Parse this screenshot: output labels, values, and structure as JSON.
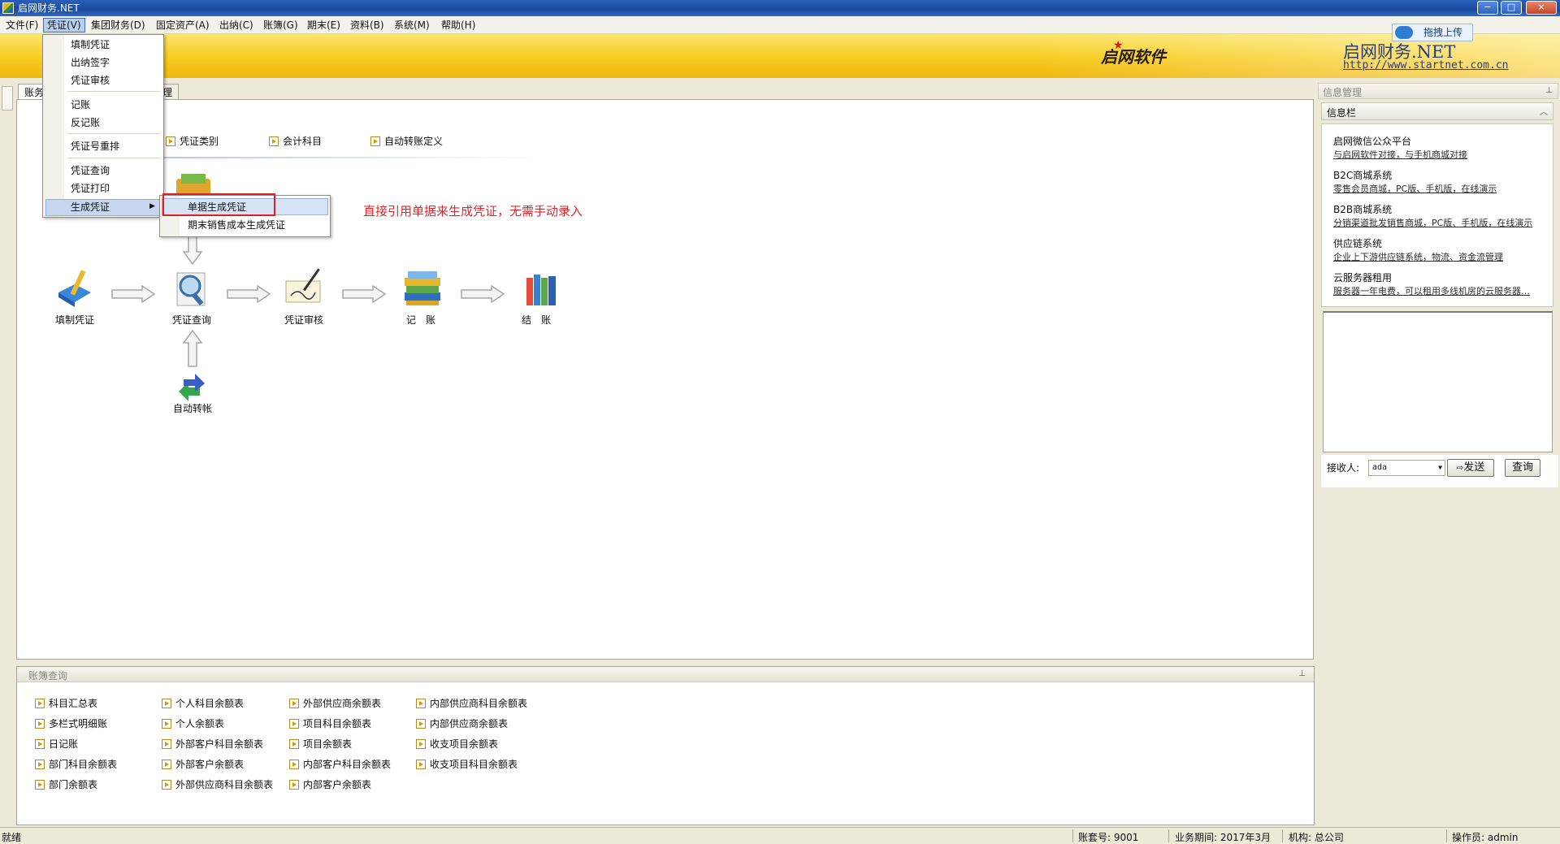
{
  "window": {
    "title": "启网财务.NET",
    "controls": {
      "minimize": "−",
      "maximize": "□",
      "close": "×"
    }
  },
  "menubar": [
    "文件(F)",
    "凭证(V)",
    "集团财务(D)",
    "固定资产(A)",
    "出纳(C)",
    "账簿(G)",
    "期末(E)",
    "资料(B)",
    "系统(M)",
    "帮助(H)"
  ],
  "banner": {
    "brand_cn": "启网软件",
    "brand_name": "启网财务.NET",
    "url": "http://www.startnet.com.cn",
    "upload_label": "拖拽上传"
  },
  "tabs": {
    "tab1": "账务",
    "tab2": "理"
  },
  "quicklinks": [
    "凭证类别",
    "会计科目",
    "自动转账定义"
  ],
  "voucher_menu": {
    "items": [
      "填制凭证",
      "出纳签字",
      "凭证审核",
      "记账",
      "反记账",
      "凭证号重排",
      "凭证查询",
      "凭证打印",
      "生成凭证"
    ],
    "submenu": [
      "单据生成凭证",
      "期末销售成本生成凭证"
    ]
  },
  "annotation": "直接引用单据来生成凭证，无需手动录入",
  "flow": {
    "steps": [
      "填制凭证",
      "凭证查询",
      "凭证审核",
      "记　账",
      "结　账"
    ],
    "auto_transfer": "自动转帐"
  },
  "ledger": {
    "title": "账簿查询",
    "columns": [
      [
        "科目汇总表",
        "多栏式明细账",
        "日记账",
        "部门科目余额表",
        "部门余额表"
      ],
      [
        "个人科目余额表",
        "个人余额表",
        "外部客户科目余额表",
        "外部客户余额表",
        "外部供应商科目余额表"
      ],
      [
        "外部供应商余额表",
        "项目科目余额表",
        "项目余额表",
        "内部客户科目余额表",
        "内部客户余额表"
      ],
      [
        "内部供应商科目余额表",
        "内部供应商余额表",
        "收支项目余额表",
        "收支项目科目余额表"
      ]
    ]
  },
  "info_panel": {
    "title": "信息管理",
    "bar_title": "信息栏",
    "items": [
      {
        "title": "启网微信公众平台",
        "desc": "与启网软件对接，与手机商城对接"
      },
      {
        "title": "B2C商城系统",
        "desc": "零售会员商城，PC版、手机版，在线演示"
      },
      {
        "title": "B2B商城系统",
        "desc": "分销渠道批发销售商城，PC版、手机版，在线演示"
      },
      {
        "title": "供应链系统",
        "desc": "企业上下游供应链系统，物流、资金流管理"
      },
      {
        "title": "云服务器租用",
        "desc": "服务器一年电费，可以租用多线机房的云服务器…"
      }
    ],
    "recipient_label": "接收人:",
    "recipient_value": "ada",
    "send_label": "发送",
    "query_label": "查询"
  },
  "statusbar": {
    "ready": "就绪",
    "account_set": "账套号: 9001",
    "period": "业务期间: 2017年3月",
    "org": "机构: 总公司",
    "operator": "操作员: admin"
  }
}
